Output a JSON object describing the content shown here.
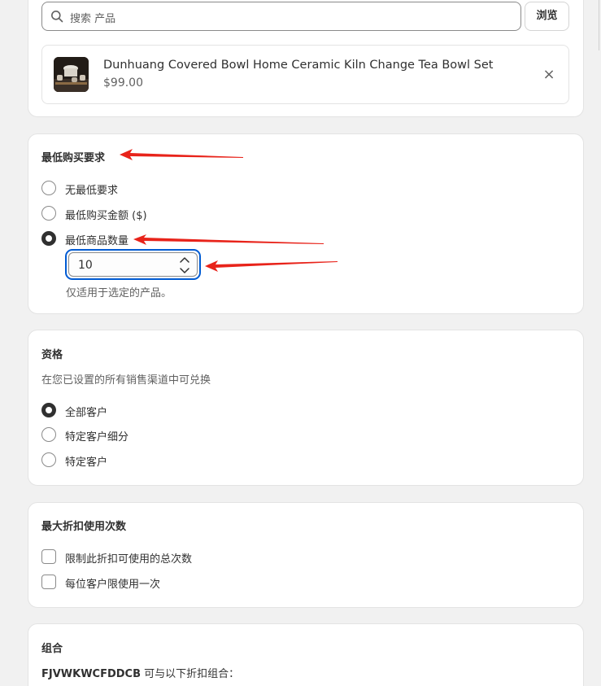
{
  "search": {
    "placeholder": "搜索 产品",
    "browse_label": "浏览"
  },
  "product": {
    "title": "Dunhuang Covered Bowl Home Ceramic Kiln Change Tea Bowl Set",
    "price": "$99.00",
    "remove_label": "×"
  },
  "min_requirements": {
    "title": "最低购买要求",
    "options": [
      {
        "label": "无最低要求",
        "checked": false
      },
      {
        "label": "最低购买金额 ($)",
        "checked": false
      },
      {
        "label": "最低商品数量",
        "checked": true
      }
    ],
    "quantity_value": "10",
    "help_text": "仅适用于选定的产品。"
  },
  "eligibility": {
    "title": "资格",
    "subtitle": "在您已设置的所有销售渠道中可兑换",
    "options": [
      {
        "label": "全部客户",
        "checked": true
      },
      {
        "label": "特定客户细分",
        "checked": false
      },
      {
        "label": "特定客户",
        "checked": false
      }
    ]
  },
  "max_uses": {
    "title": "最大折扣使用次数",
    "options": [
      {
        "label": "限制此折扣可使用的总次数",
        "checked": false
      },
      {
        "label": "每位客户限使用一次",
        "checked": false
      }
    ]
  },
  "combinations": {
    "title": "组合",
    "code": "FJVWKWCFDDCB",
    "text": " 可与以下折扣组合："
  },
  "colors": {
    "focus": "#005bd3",
    "annotation_arrow": "#e8231a"
  },
  "icons": [
    "search-icon",
    "close-icon",
    "chevron-up-icon",
    "chevron-down-icon"
  ]
}
